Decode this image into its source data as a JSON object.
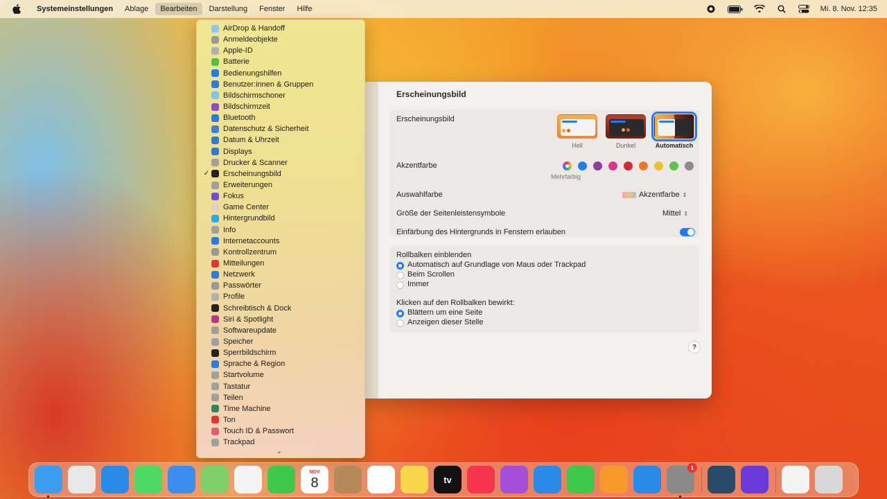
{
  "menubar": {
    "app": "Systemeinstellungen",
    "items": [
      "Ablage",
      "Bearbeiten",
      "Darstellung",
      "Fenster",
      "Hilfe"
    ],
    "active_index": 1,
    "clock": "Mi. 8. Nov.  12:35"
  },
  "window": {
    "title": "Erscheinungsbild",
    "appearance": {
      "label": "Erscheinungsbild",
      "options": [
        "Hell",
        "Dunkel",
        "Automatisch"
      ],
      "selected": "Automatisch"
    },
    "accent": {
      "label": "Akzentfarbe",
      "colors": [
        "#1f7cf4",
        "#8a3ea6",
        "#d8368f",
        "#d02a38",
        "#e8782a",
        "#f0c02c",
        "#5ec24b",
        "#8c8c8c"
      ],
      "multicolor_caption": "Mehrfarbig"
    },
    "highlight": {
      "label": "Auswahlfarbe",
      "value": "Akzentfarbe"
    },
    "sidebar_icon_size": {
      "label": "Größe der Seitenleistensymbole",
      "value": "Mittel"
    },
    "wallpaper_tinting": {
      "label": "Einfärbung des Hintergrunds in Fenstern erlauben",
      "on": true
    },
    "scrollbars": {
      "label": "Rollbalken einblenden",
      "options": [
        "Automatisch auf Grundlage von Maus oder Trackpad",
        "Beim Scrollen",
        "Immer"
      ],
      "selected_index": 0
    },
    "click_scrollbar": {
      "label": "Klicken auf den Rollbalken bewirkt:",
      "options": [
        "Blättern um eine Seite",
        "Anzeigen dieser Stelle"
      ],
      "selected_index": 0
    },
    "help": "?"
  },
  "menu": {
    "checked": "Erscheinungsbild",
    "items": [
      {
        "label": "AirDrop & Handoff",
        "color": "#8ec8f0"
      },
      {
        "label": "Anmeldeobjekte",
        "color": "#9a9a9a"
      },
      {
        "label": "Apple-ID",
        "color": "#b0b0b0"
      },
      {
        "label": "Batterie",
        "color": "#55c23c"
      },
      {
        "label": "Bedienungshilfen",
        "color": "#1f7cf4"
      },
      {
        "label": "Benutzer:innen & Gruppen",
        "color": "#2a7ce0"
      },
      {
        "label": "Bildschirmschoner",
        "color": "#7cc6ea"
      },
      {
        "label": "Bildschirmzeit",
        "color": "#8a4bd6"
      },
      {
        "label": "Bluetooth",
        "color": "#1f7cf4"
      },
      {
        "label": "Datenschutz & Sicherheit",
        "color": "#3b7fe0"
      },
      {
        "label": "Datum & Uhrzeit",
        "color": "#2a7ce0"
      },
      {
        "label": "Displays",
        "color": "#2a7ce0"
      },
      {
        "label": "Drucker & Scanner",
        "color": "#a0a0a0"
      },
      {
        "label": "Erscheinungsbild",
        "color": "#222222"
      },
      {
        "label": "Erweiterungen",
        "color": "#a0a0a0"
      },
      {
        "label": "Fokus",
        "color": "#6b4fd8"
      },
      {
        "label": "Game Center",
        "color": "#e0d0c0"
      },
      {
        "label": "Hintergrundbild",
        "color": "#2fa9e8"
      },
      {
        "label": "Info",
        "color": "#a0a0a0"
      },
      {
        "label": "Internetaccounts",
        "color": "#2a7ce0"
      },
      {
        "label": "Kontrollzentrum",
        "color": "#9a9a9a"
      },
      {
        "label": "Mitteilungen",
        "color": "#e0362e"
      },
      {
        "label": "Netzwerk",
        "color": "#2a7ce0"
      },
      {
        "label": "Passwörter",
        "color": "#9a9a9a"
      },
      {
        "label": "Profile",
        "color": "#b0b0b0"
      },
      {
        "label": "Schreibtisch & Dock",
        "color": "#222222"
      },
      {
        "label": "Siri & Spotlight",
        "color": "#c0308a"
      },
      {
        "label": "Softwareupdate",
        "color": "#a0a0a0"
      },
      {
        "label": "Speicher",
        "color": "#a0a0a0"
      },
      {
        "label": "Sperrbildschirm",
        "color": "#222222"
      },
      {
        "label": "Sprache & Region",
        "color": "#2a7ce0"
      },
      {
        "label": "Startvolume",
        "color": "#a0a0a0"
      },
      {
        "label": "Tastatur",
        "color": "#a0a0a0"
      },
      {
        "label": "Teilen",
        "color": "#a0a0a0"
      },
      {
        "label": "Time Machine",
        "color": "#2a8a5a"
      },
      {
        "label": "Ton",
        "color": "#e0362e"
      },
      {
        "label": "Touch ID & Passwort",
        "color": "#e85a7a"
      },
      {
        "label": "Trackpad",
        "color": "#a0a0a0"
      }
    ]
  },
  "dock": {
    "calendar_month": "NOV",
    "calendar_day": "8",
    "tv_label": "tv",
    "settings_badge": "1",
    "apps": [
      {
        "name": "finder",
        "color": "#3b9df0"
      },
      {
        "name": "launchpad",
        "color": "#e8e8e8"
      },
      {
        "name": "safari",
        "color": "#2a8ae8"
      },
      {
        "name": "messages",
        "color": "#4cd964"
      },
      {
        "name": "mail",
        "color": "#3b8ef0"
      },
      {
        "name": "maps",
        "color": "#7fcf6a"
      },
      {
        "name": "photos",
        "color": "#f4f4f4"
      },
      {
        "name": "facetime",
        "color": "#3ec94a"
      },
      {
        "name": "calendar",
        "color": "#ffffff"
      },
      {
        "name": "contacts",
        "color": "#b48a5a"
      },
      {
        "name": "reminders",
        "color": "#ffffff"
      },
      {
        "name": "notes",
        "color": "#f7d64a"
      },
      {
        "name": "tv",
        "color": "#111111"
      },
      {
        "name": "music",
        "color": "#f5364e"
      },
      {
        "name": "podcasts",
        "color": "#a44fd8"
      },
      {
        "name": "keynote",
        "color": "#2a8ae8"
      },
      {
        "name": "numbers",
        "color": "#3ec94a"
      },
      {
        "name": "pages",
        "color": "#f59a2a"
      },
      {
        "name": "app-store",
        "color": "#2a8ae8"
      },
      {
        "name": "system-settings",
        "color": "#8a8a8a"
      }
    ]
  }
}
